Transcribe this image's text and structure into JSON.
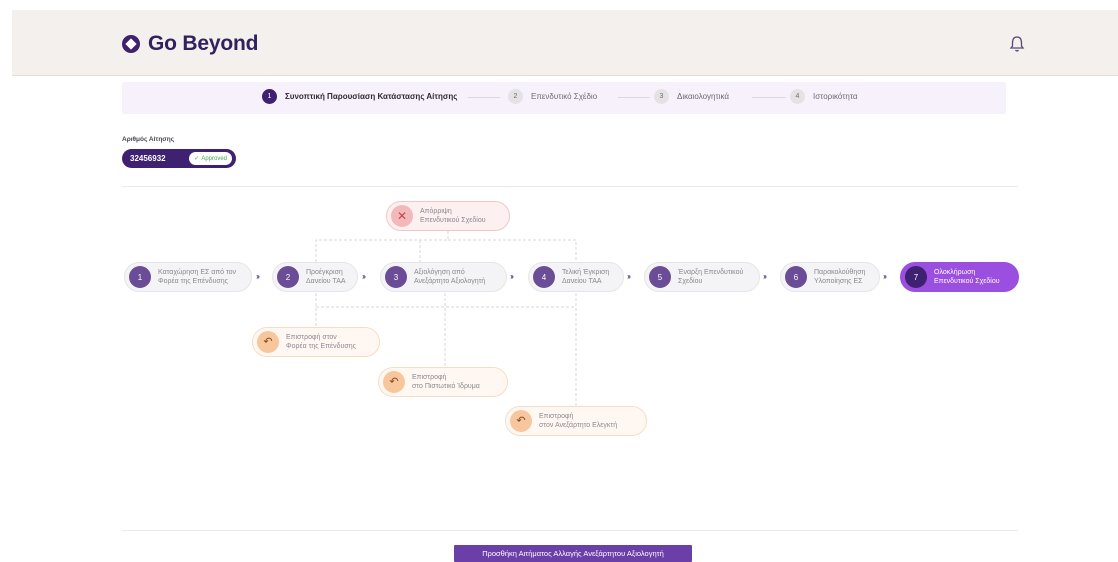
{
  "brand": {
    "name": "Go Beyond"
  },
  "stepper": [
    {
      "num": "1",
      "label": "Συνοπτική Παρουσίαση Κατάστασης Αίτησης",
      "active": true
    },
    {
      "num": "2",
      "label": "Επενδυτικό Σχέδιο",
      "active": false
    },
    {
      "num": "3",
      "label": "Δικαιολογητικά",
      "active": false
    },
    {
      "num": "4",
      "label": "Ιστορικότητα",
      "active": false
    }
  ],
  "application": {
    "label": "Αριθμός Αίτησης",
    "id": "32456932",
    "status": "Approved"
  },
  "flow": {
    "steps": [
      {
        "num": "1",
        "label": "Καταχώρηση ΕΣ από τον\nΦορέα της Επένδυσης"
      },
      {
        "num": "2",
        "label": "Προέγκριση\nΔανείου ΤΑΑ"
      },
      {
        "num": "3",
        "label": "Αξιολόγηση από\nΑνεξάρτητο Αξιολογητή"
      },
      {
        "num": "4",
        "label": "Τελική Έγκριση\nΔανείου ΤΑΑ"
      },
      {
        "num": "5",
        "label": "Έναρξη Επενδυτικού\nΣχεδίου"
      },
      {
        "num": "6",
        "label": "Παρακολούθηση\nΥλοποίησης ΕΣ"
      },
      {
        "num": "7",
        "label": "Ολοκλήρωση\nΕπενδυτικού Σχεδίου"
      }
    ],
    "reject": {
      "label": "Απόρριψη\nΕπενδυτικού Σχεδίου"
    },
    "returns": [
      {
        "label": "Επιστροφή στον\nΦορέα της Επένδυσης"
      },
      {
        "label": "Επιστροφή\nστο Πιστωτικό Ίδρυμα"
      },
      {
        "label": "Επιστροφή\nστον Ανεξάρτητο Ελεγκτή"
      }
    ],
    "arrow": "›››"
  },
  "actions": {
    "add_request": "Προσθήκη Αιτήματος Αλλαγής Ανεξάρτητου Αξιολογητή"
  },
  "colors": {
    "primary": "#3e2170",
    "final": "#9b4fe0",
    "approved": "#4aa45e",
    "reject": "#f3b8ba",
    "return": "#f8c69d"
  },
  "icons": {
    "brand": "go-beyond-logo-icon",
    "notifications": "bell-icon",
    "reject": "close-icon",
    "return": "undo-icon",
    "approved": "check-icon"
  }
}
